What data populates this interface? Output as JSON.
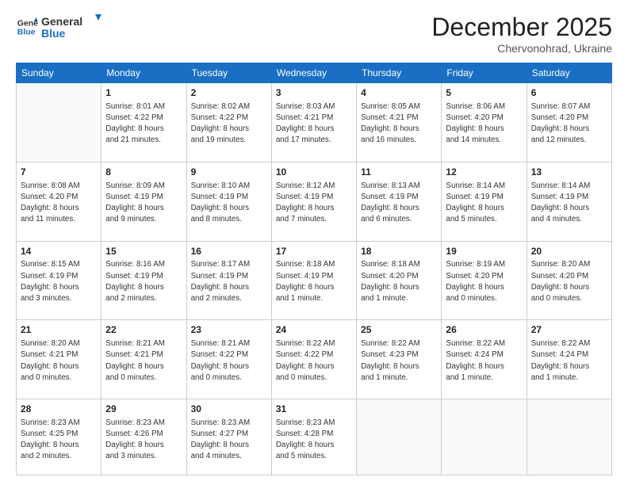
{
  "logo": {
    "line1": "General",
    "line2": "Blue"
  },
  "title": "December 2025",
  "subtitle": "Chervonohrad, Ukraine",
  "days_of_week": [
    "Sunday",
    "Monday",
    "Tuesday",
    "Wednesday",
    "Thursday",
    "Friday",
    "Saturday"
  ],
  "weeks": [
    [
      {
        "day": "",
        "info": ""
      },
      {
        "day": "1",
        "info": "Sunrise: 8:01 AM\nSunset: 4:22 PM\nDaylight: 8 hours\nand 21 minutes."
      },
      {
        "day": "2",
        "info": "Sunrise: 8:02 AM\nSunset: 4:22 PM\nDaylight: 8 hours\nand 19 minutes."
      },
      {
        "day": "3",
        "info": "Sunrise: 8:03 AM\nSunset: 4:21 PM\nDaylight: 8 hours\nand 17 minutes."
      },
      {
        "day": "4",
        "info": "Sunrise: 8:05 AM\nSunset: 4:21 PM\nDaylight: 8 hours\nand 16 minutes."
      },
      {
        "day": "5",
        "info": "Sunrise: 8:06 AM\nSunset: 4:20 PM\nDaylight: 8 hours\nand 14 minutes."
      },
      {
        "day": "6",
        "info": "Sunrise: 8:07 AM\nSunset: 4:20 PM\nDaylight: 8 hours\nand 12 minutes."
      }
    ],
    [
      {
        "day": "7",
        "info": "Sunrise: 8:08 AM\nSunset: 4:20 PM\nDaylight: 8 hours\nand 11 minutes."
      },
      {
        "day": "8",
        "info": "Sunrise: 8:09 AM\nSunset: 4:19 PM\nDaylight: 8 hours\nand 9 minutes."
      },
      {
        "day": "9",
        "info": "Sunrise: 8:10 AM\nSunset: 4:19 PM\nDaylight: 8 hours\nand 8 minutes."
      },
      {
        "day": "10",
        "info": "Sunrise: 8:12 AM\nSunset: 4:19 PM\nDaylight: 8 hours\nand 7 minutes."
      },
      {
        "day": "11",
        "info": "Sunrise: 8:13 AM\nSunset: 4:19 PM\nDaylight: 8 hours\nand 6 minutes."
      },
      {
        "day": "12",
        "info": "Sunrise: 8:14 AM\nSunset: 4:19 PM\nDaylight: 8 hours\nand 5 minutes."
      },
      {
        "day": "13",
        "info": "Sunrise: 8:14 AM\nSunset: 4:19 PM\nDaylight: 8 hours\nand 4 minutes."
      }
    ],
    [
      {
        "day": "14",
        "info": "Sunrise: 8:15 AM\nSunset: 4:19 PM\nDaylight: 8 hours\nand 3 minutes."
      },
      {
        "day": "15",
        "info": "Sunrise: 8:16 AM\nSunset: 4:19 PM\nDaylight: 8 hours\nand 2 minutes."
      },
      {
        "day": "16",
        "info": "Sunrise: 8:17 AM\nSunset: 4:19 PM\nDaylight: 8 hours\nand 2 minutes."
      },
      {
        "day": "17",
        "info": "Sunrise: 8:18 AM\nSunset: 4:19 PM\nDaylight: 8 hours\nand 1 minute."
      },
      {
        "day": "18",
        "info": "Sunrise: 8:18 AM\nSunset: 4:20 PM\nDaylight: 8 hours\nand 1 minute."
      },
      {
        "day": "19",
        "info": "Sunrise: 8:19 AM\nSunset: 4:20 PM\nDaylight: 8 hours\nand 0 minutes."
      },
      {
        "day": "20",
        "info": "Sunrise: 8:20 AM\nSunset: 4:20 PM\nDaylight: 8 hours\nand 0 minutes."
      }
    ],
    [
      {
        "day": "21",
        "info": "Sunrise: 8:20 AM\nSunset: 4:21 PM\nDaylight: 8 hours\nand 0 minutes."
      },
      {
        "day": "22",
        "info": "Sunrise: 8:21 AM\nSunset: 4:21 PM\nDaylight: 8 hours\nand 0 minutes."
      },
      {
        "day": "23",
        "info": "Sunrise: 8:21 AM\nSunset: 4:22 PM\nDaylight: 8 hours\nand 0 minutes."
      },
      {
        "day": "24",
        "info": "Sunrise: 8:22 AM\nSunset: 4:22 PM\nDaylight: 8 hours\nand 0 minutes."
      },
      {
        "day": "25",
        "info": "Sunrise: 8:22 AM\nSunset: 4:23 PM\nDaylight: 8 hours\nand 1 minute."
      },
      {
        "day": "26",
        "info": "Sunrise: 8:22 AM\nSunset: 4:24 PM\nDaylight: 8 hours\nand 1 minute."
      },
      {
        "day": "27",
        "info": "Sunrise: 8:22 AM\nSunset: 4:24 PM\nDaylight: 8 hours\nand 1 minute."
      }
    ],
    [
      {
        "day": "28",
        "info": "Sunrise: 8:23 AM\nSunset: 4:25 PM\nDaylight: 8 hours\nand 2 minutes."
      },
      {
        "day": "29",
        "info": "Sunrise: 8:23 AM\nSunset: 4:26 PM\nDaylight: 8 hours\nand 3 minutes."
      },
      {
        "day": "30",
        "info": "Sunrise: 8:23 AM\nSunset: 4:27 PM\nDaylight: 8 hours\nand 4 minutes."
      },
      {
        "day": "31",
        "info": "Sunrise: 8:23 AM\nSunset: 4:28 PM\nDaylight: 8 hours\nand 5 minutes."
      },
      {
        "day": "",
        "info": ""
      },
      {
        "day": "",
        "info": ""
      },
      {
        "day": "",
        "info": ""
      }
    ]
  ]
}
